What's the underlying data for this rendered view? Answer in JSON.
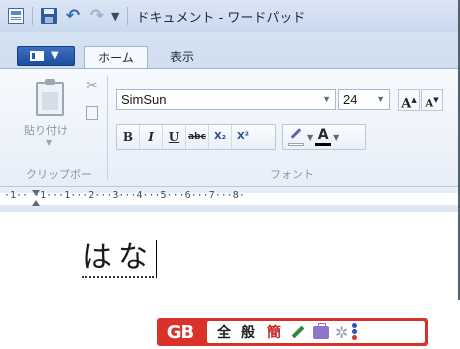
{
  "window": {
    "title": "ドキュメント - ワードパッド",
    "qat": {
      "menu_arrow": "▼"
    }
  },
  "tabs": {
    "file_arrow": "▼",
    "home": "ホーム",
    "view": "表示"
  },
  "clipboard": {
    "paste_label": "貼り付け",
    "group_label": "クリップボード",
    "cut_glyph": "✂"
  },
  "font": {
    "name": "SimSun",
    "size": "24",
    "grow_label": "A",
    "shrink_label": "A",
    "group_label": "フォント",
    "buttons": {
      "bold": "B",
      "italic": "I",
      "underline": "U",
      "strike": "abc",
      "subscript": "X₂",
      "superscript": "X²"
    },
    "font_color_label": "A"
  },
  "ruler": {
    "text": "·1·· ·1···1···2···3···4···5···6···7···8·"
  },
  "document": {
    "text": "はな"
  },
  "ime": {
    "logo": "GB",
    "full_width": "全",
    "punct": "般",
    "simplified": "簡"
  },
  "colors": {
    "accent": "#1c4f9c",
    "ime_red": "#d9322b"
  }
}
